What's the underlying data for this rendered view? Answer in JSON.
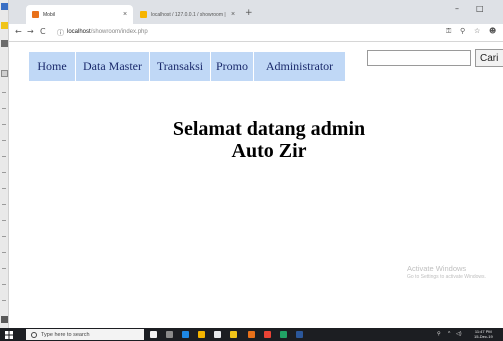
{
  "browser": {
    "tabs": [
      {
        "title": "Mobil",
        "close": "×",
        "active": true,
        "favicon_color": "#e8711a"
      },
      {
        "title": "localhost / 127.0.0.1 / showroom | ",
        "close": "×",
        "active": false,
        "favicon_color": "#f6b400"
      }
    ],
    "new_tab": "+",
    "window_controls": {
      "minimize": "–",
      "maximize": "□"
    },
    "nav": {
      "back": "←",
      "forward": "→",
      "reload": "C"
    },
    "address_host": "localhost",
    "address_path": "/showroom/index.php"
  },
  "page": {
    "navbar": {
      "bg_color": "#c0d8f6",
      "items": [
        {
          "label": "Home"
        },
        {
          "label": "Data Master"
        },
        {
          "label": "Transaksi"
        },
        {
          "label": "Promo"
        },
        {
          "label": "Administrator"
        }
      ]
    },
    "search": {
      "value": "",
      "button": "Cari"
    },
    "welcome": {
      "line1": "Selamat datang admin",
      "line2": "Auto Zir"
    },
    "watermark": {
      "title": "Activate Windows",
      "subtitle": "Go to Settings to activate Windows."
    }
  },
  "taskbar": {
    "search_placeholder": "Type here to search",
    "clock_time": "11:47 PM",
    "clock_date": "15-Dec-19",
    "app_colors": [
      "#f2f2f2",
      "#8a8a8a",
      "#1e88e5",
      "#f4b400",
      "#e8eaed",
      "#f0c419",
      "#e8711a",
      "#ea4335",
      "#21a366",
      "#2b579a"
    ]
  }
}
